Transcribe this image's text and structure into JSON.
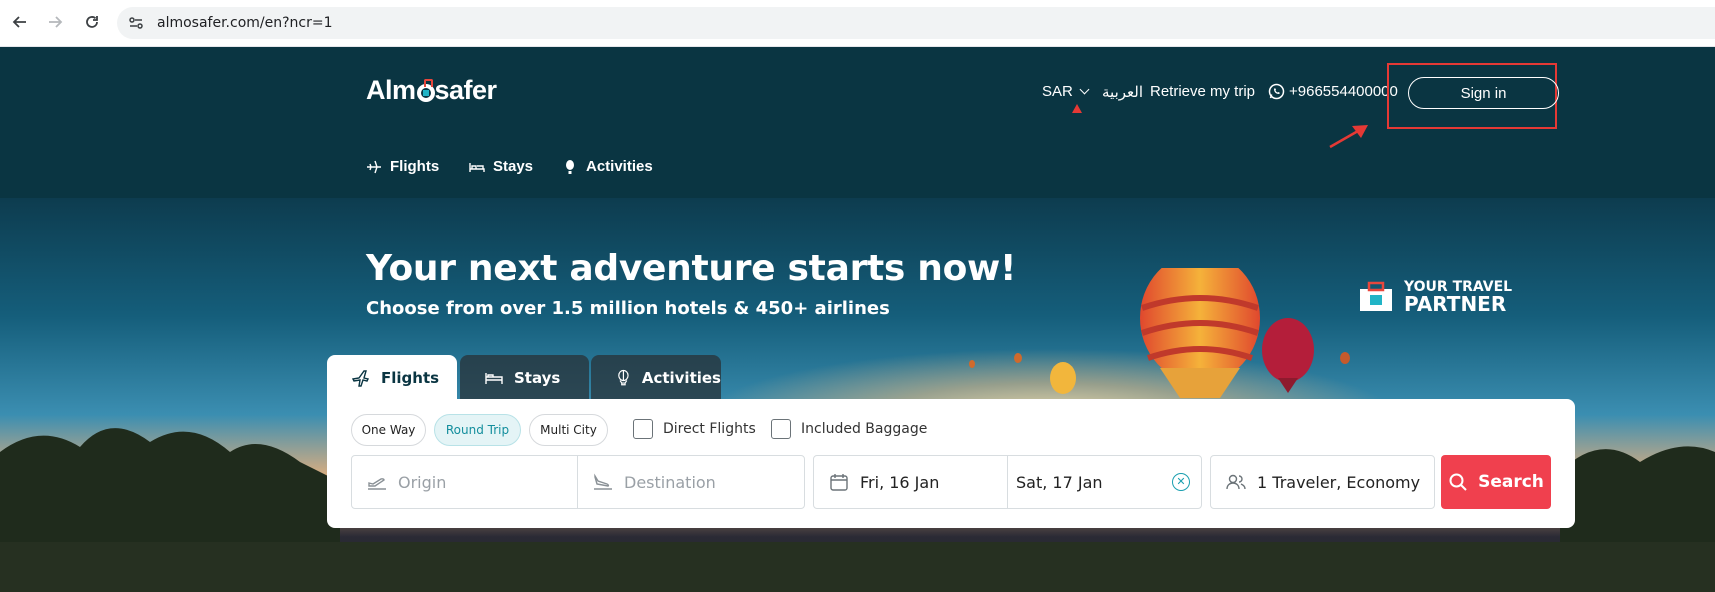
{
  "browser": {
    "url": "almosafer.com/en?ncr=1",
    "back_icon": "arrow-left-icon",
    "forward_icon": "arrow-right-icon",
    "reload_icon": "reload-icon"
  },
  "header": {
    "logo_text_a": "Alm",
    "logo_text_b": "safer",
    "currency": "SAR",
    "language": "العربية",
    "retrieve_trip": "Retrieve my trip",
    "phone": "+966554400000",
    "sign_in": "Sign in",
    "nav": [
      {
        "label": "Flights",
        "icon": "plane-icon"
      },
      {
        "label": "Stays",
        "icon": "bed-icon"
      },
      {
        "label": "Activities",
        "icon": "balloon-icon"
      }
    ]
  },
  "hero": {
    "title": "Your next adventure starts now!",
    "subtitle": "Choose from over 1.5 million hotels & 450+ airlines",
    "partner_line1": "YOUR TRAVEL",
    "partner_line2": "PARTNER"
  },
  "search": {
    "tabs": [
      {
        "label": "Flights",
        "icon": "plane-icon",
        "active": true
      },
      {
        "label": "Stays",
        "icon": "bed-icon",
        "active": false
      },
      {
        "label": "Activities",
        "icon": "balloon-icon",
        "active": false
      }
    ],
    "trip_types": [
      {
        "label": "One Way",
        "active": false
      },
      {
        "label": "Round Trip",
        "active": true
      },
      {
        "label": "Multi City",
        "active": false
      }
    ],
    "direct_flights": "Direct Flights",
    "included_baggage": "Included Baggage",
    "origin_placeholder": "Origin",
    "destination_placeholder": "Destination",
    "depart_date": "Fri, 16 Jan",
    "return_date": "Sat, 17 Jan",
    "travelers": "1 Traveler, Economy",
    "search_label": "Search",
    "accent_color": "#f0404e",
    "active_pill_color": "#138e9d"
  },
  "colors": {
    "header_bg": "#0a3542",
    "annotation": "#e53935"
  }
}
